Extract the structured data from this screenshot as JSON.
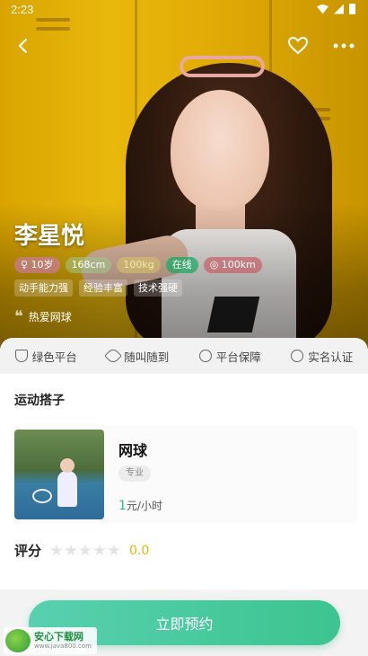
{
  "status_bar": {
    "time": "2:23"
  },
  "profile": {
    "name": "李星悦",
    "tags": [
      "10岁",
      "168cm",
      "100kg",
      "在线",
      "100km"
    ],
    "skills": [
      "动手能力强",
      "经验丰富",
      "技术强硬"
    ],
    "quote": "热爱网球"
  },
  "features": [
    "绿色平台",
    "随叫随到",
    "平台保障",
    "实名认证"
  ],
  "section_title": "运动搭子",
  "service": {
    "title": "网球",
    "badge": "专业",
    "price_value": "1",
    "price_unit": "元/小时"
  },
  "rating": {
    "label": "评分",
    "score": "0.0",
    "stars": 0,
    "max_stars": 5
  },
  "cta": {
    "label": "立即预约"
  },
  "watermark": {
    "line1": "安心下载网",
    "line2": "www.java800.com"
  },
  "icons": [
    "back-icon",
    "heart-icon",
    "more-icon",
    "shield-icon",
    "rocket-icon",
    "user-icon",
    "badge-icon",
    "star-icon"
  ],
  "colors": {
    "accent": "#3dc48f",
    "score": "#e8b400",
    "online": "#1eaa64"
  }
}
